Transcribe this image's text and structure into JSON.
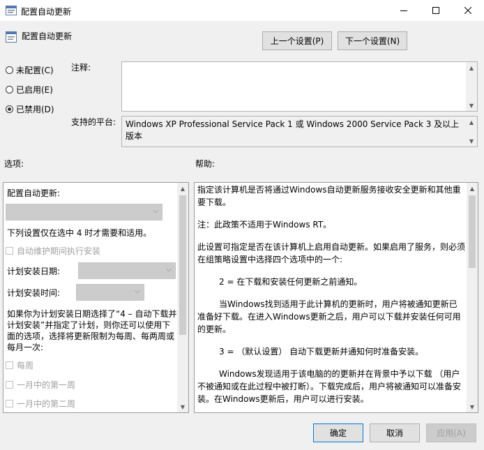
{
  "window": {
    "title": "配置自动更新",
    "icon": "policy-icon",
    "minimize_glyph": "—",
    "maximize_glyph": "☐",
    "close_glyph": "✕"
  },
  "header": {
    "policy_title": "配置自动更新",
    "prev_button": "上一个设置(P)",
    "next_button": "下一个设置(N)"
  },
  "state": {
    "options": [
      {
        "label": "未配置(C)",
        "checked": false
      },
      {
        "label": "已启用(E)",
        "checked": false
      },
      {
        "label": "已禁用(D)",
        "checked": true
      }
    ]
  },
  "comment": {
    "label": "注释:",
    "value": ""
  },
  "platform": {
    "label": "支持的平台:",
    "value": "Windows XP Professional Service Pack 1 或 Windows 2000 Service Pack 3 及以上版本"
  },
  "sections": {
    "options_label": "选项:",
    "help_label": "帮助:"
  },
  "options_panel": {
    "configure_label": "配置自动更新:",
    "configure_value": "",
    "note": "下列设置仅在选中 4 时才需要和适用。",
    "auto_maintenance": "自动维护期间执行安装",
    "schedule_day_label": "计划安装日期:",
    "schedule_day_value": "",
    "schedule_time_label": "计划安装时间:",
    "schedule_time_value": "",
    "explanation": "如果你为计划安装日期选择了“4 – 自动下载并计划安装”并指定了计划，则你还可以使用下面的选项，选择将更新限制为每周、每两周或每月一次:",
    "weekly": "每周",
    "first_week": "一月中的第一周",
    "second_week": "一月中的第二周"
  },
  "help_panel": {
    "paragraphs": [
      "指定该计算机是否将通过Windows自动更新服务接收安全更新和其他重要下载。",
      "注：此政策不适用于Windows RT。",
      "此设置可指定是否在该计算机上启用自动更新。如果启用了服务，则必须在组策略设置中选择四个选项中的一个:",
      "2 = 在下载和安装任何更新之前通知。",
      "当Windows找到适用于此计算机的更新时，用户将被通知更新已准备好下载。在进入Windows更新之后，用户可以下载并安装任何可用的更新。",
      "3 = （默认设置） 自动下载更新并通知何时准备安装。",
      "Windows发现适用于该电脑的的更新并在背景中予以下载 （用户不被通知或在此过程中被打断）。下载完成后，用户将被通知可以准备安装。在Windows更新后，用户可以进行安装。"
    ]
  },
  "footer": {
    "ok": "确定",
    "cancel": "取消",
    "apply": "应用(A)"
  },
  "colors": {
    "accent": "#0078d7",
    "window_bg": "#f0f0f0",
    "disabled_text": "#a0a0a0"
  }
}
